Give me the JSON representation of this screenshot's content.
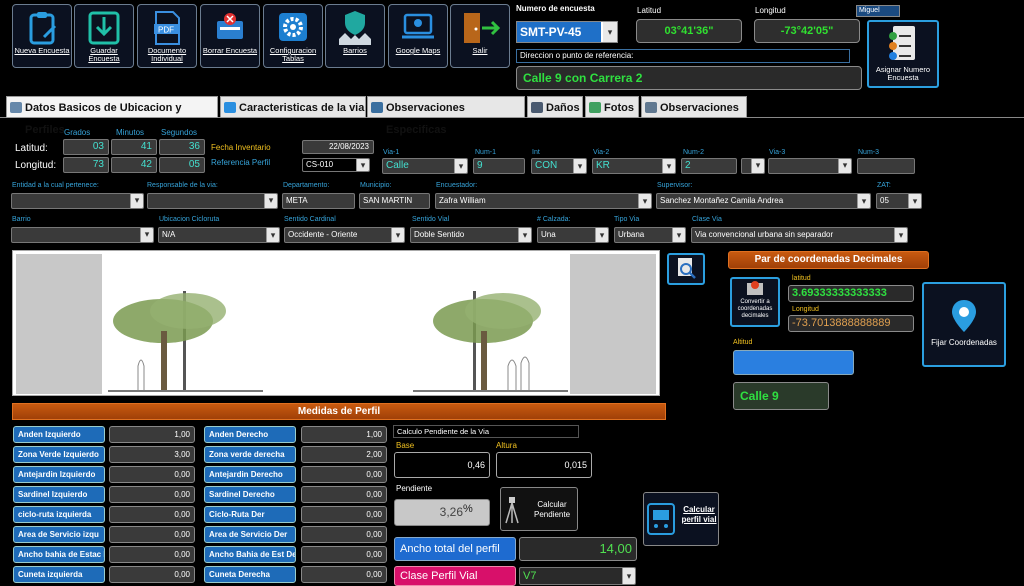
{
  "toolbar": {
    "nueva": "Nueva Encuesta",
    "guardar": "Guardar Encuesta",
    "documento": "Documento Individual",
    "pdf": "PDF",
    "borrar": "Borrar Encuesta",
    "config": "Configuracion Tablas",
    "barrios": "Barrios",
    "maps": "Google Maps",
    "salir": "Salir"
  },
  "header": {
    "numero_label": "Numero de encuesta",
    "numero_value": "SMT-PV-45",
    "lat_label": "Latitud",
    "lat_value": "03°41'36\"",
    "lon_label": "Longitud",
    "lon_value": "-73°42'05\"",
    "user": "Miguel",
    "dir_label": "Direccion o punto de referencia:",
    "dir_value": "Calle 9 con Carrera 2",
    "asignar": "Asignar Numero Encuesta"
  },
  "tabs": [
    "Datos Basicos de Ubicacion y Perfiles",
    "Caracteristicas de la via",
    "Observaciones Especificas",
    "Daños",
    "Fotos",
    "Observaciones"
  ],
  "coords": {
    "grados": "Grados",
    "minutos": "Minutos",
    "segundos": "Segundos",
    "latitud": "Latitud:",
    "longitud": "Longitud:",
    "lat_g": "03",
    "lat_m": "41",
    "lat_s": "36",
    "lon_g": "73",
    "lon_m": "42",
    "lon_s": "05",
    "fecha_label": "Fecha Inventario",
    "fecha": "22/08/2023",
    "ref_label": "Referencia Perfil",
    "ref": "CS-010"
  },
  "via": {
    "via1_l": "Via-1",
    "via1": "Calle",
    "num1_l": "Num-1",
    "num1": "9",
    "int_l": "Int",
    "int": "CON",
    "via2_l": "Via-2",
    "via2": "KR",
    "num2_l": "Num-2",
    "num2": "2",
    "via3_l": "Via-3",
    "via3": "",
    "num3_l": "Num-3",
    "num3": ""
  },
  "row2": {
    "entidad_l": "Entidad a la cual pertenece:",
    "responsable_l": "Responsable de la via:",
    "depto_l": "Departamento:",
    "depto": "META",
    "muni_l": "Municipio:",
    "muni": "SAN MARTIN",
    "enc_l": "Encuestador:",
    "enc": "Zafra William",
    "sup_l": "Supervisor:",
    "sup": "Sanchez Montañez Camila Andrea",
    "zat_l": "ZAT:",
    "zat": "05"
  },
  "row3": {
    "barrio_l": "Barrio",
    "ciclo_l": "Ubicacion Cicloruta",
    "ciclo": "N/A",
    "sentc_l": "Sentido  Cardinal",
    "sentc": "Occidente - Oriente",
    "sentv_l": "Sentido  Vial",
    "sentv": "Doble Sentido",
    "calz_l": "# Calzada:",
    "calz": "Una",
    "tipo_l": "Tipo Via",
    "tipo": "Urbana",
    "clase_l": "Clase Via",
    "clase": "Via convencional urbana sin separador"
  },
  "decimal": {
    "title": "Par de coordenadas Decimales",
    "convertir": "Convertir a coordenadas decimales",
    "lat_l": "latitud",
    "lat": "3.69333333333333",
    "lon_l": "Longitud",
    "lon": "-73.7013888888889",
    "alt_l": "Altitud",
    "alt": "",
    "calle": "Calle 9",
    "fijar": "Fijar Coordenadas"
  },
  "medidas": {
    "title": "Medidas de Perfil",
    "left": [
      {
        "l": "Anden Izquierdo",
        "v": "1,00"
      },
      {
        "l": "Zona Verde Izquierdo",
        "v": "3,00"
      },
      {
        "l": "Antejardin Izquierdo",
        "v": "0,00"
      },
      {
        "l": "Sardinel Izquierdo",
        "v": "0,00"
      },
      {
        "l": "ciclo-ruta izquierda",
        "v": "0,00"
      },
      {
        "l": "Area de Servicio izqu",
        "v": "0,00"
      },
      {
        "l": "Ancho bahia de Estac I",
        "v": "0,00"
      },
      {
        "l": "Cuneta izquierda",
        "v": "0,00"
      }
    ],
    "right": [
      {
        "l": "Anden Derecho",
        "v": "1,00"
      },
      {
        "l": "Zona verde derecha",
        "v": "2,00"
      },
      {
        "l": "Antejardin Derecho",
        "v": "0,00"
      },
      {
        "l": "Sardinel Derecho",
        "v": "0,00"
      },
      {
        "l": "Ciclo-Ruta Der",
        "v": "0,00"
      },
      {
        "l": "Area de Servicio Der",
        "v": "0,00"
      },
      {
        "l": "Ancho Bahia de Est De",
        "v": "0,00"
      },
      {
        "l": "Cuneta Derecha",
        "v": "0,00"
      }
    ]
  },
  "pendiente": {
    "title": "Calculo Pendiente de la Via",
    "base_l": "Base",
    "altura_l": "Altura",
    "base": "0,46",
    "altura": "0,015",
    "pend_l": "Pendiente",
    "pend": "3,26",
    "pct": "%",
    "calc": "Calcular Pendiente",
    "perfil": "Calcular perfil vial"
  },
  "total": {
    "ancho_l": "Ancho total del perfil",
    "ancho": "14,00",
    "clase_l": "Clase Perfil Vial",
    "clase": "V7"
  }
}
